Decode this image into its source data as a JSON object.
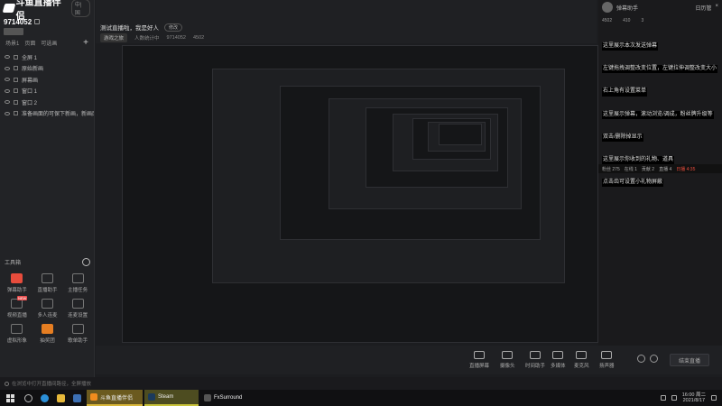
{
  "app": {
    "name": "斗鱼直播伴侣",
    "version_badge": "中|国"
  },
  "room": {
    "id": "9714052"
  },
  "scenes": {
    "tabs": [
      "场景1",
      "页面",
      "可选画"
    ],
    "add": "+"
  },
  "sources": [
    {
      "label": "全屏 1"
    },
    {
      "label": "原始新画"
    },
    {
      "label": "屏幕画"
    },
    {
      "label": "窗口 1"
    },
    {
      "label": "窗口 2"
    },
    {
      "label": "准备画面的可保下新画，新画面"
    }
  ],
  "toolbox": {
    "title": "工具箱",
    "tools": [
      {
        "label": "弹幕助手",
        "color": "red",
        "tag": ""
      },
      {
        "label": "直播助手",
        "color": "",
        "tag": ""
      },
      {
        "label": "主播任务",
        "color": "",
        "tag": ""
      },
      {
        "label": "视频直播",
        "color": "",
        "tag": "NEW"
      },
      {
        "label": "多人连麦",
        "color": "",
        "tag": ""
      },
      {
        "label": "连麦设置",
        "color": "",
        "tag": ""
      },
      {
        "label": "虚拟形象",
        "color": "",
        "tag": ""
      },
      {
        "label": "抽奖团",
        "color": "orange",
        "tag": ""
      },
      {
        "label": "歌单助手",
        "color": "",
        "tag": ""
      }
    ]
  },
  "broadcast": {
    "title": "测试直播啦，我是好人",
    "edit_label": "修改",
    "category": "游戏之旅",
    "meta": [
      "人数统计中",
      "9714052",
      "4502"
    ]
  },
  "right_panel": {
    "header_name": "弹幕助手",
    "links": [
      "日历管",
      "×"
    ],
    "stats": [
      "4502",
      "410",
      "3"
    ],
    "chat": [
      "这里展示本次发送弹幕",
      "左键拖拽调整改变位置，左键拉伸调整改变大小",
      "右上角有设置菜单",
      "这里展示弹幕，滚动浏览/调成，粉丝牌升级等",
      "双击/删除掉显示",
      "这里展示你收到的礼物、道具",
      "点击齿可设置小礼物屏蔽"
    ],
    "bottom": [
      "粉丝 275",
      "在线 1",
      "贡献 2",
      "直播 4"
    ],
    "live_text": "日播 4:35"
  },
  "controls": {
    "buttons": [
      "直播屏幕",
      "摄像头",
      "时间助手",
      "多媒体",
      "麦克风",
      "扬声器"
    ],
    "start_label": "结束直播"
  },
  "status_bar": {
    "text": "在浏览中打开直播间路径，全屏播放"
  },
  "taskbar": {
    "tasks": [
      "斗鱼直播伴侣",
      "Steam",
      "FxSurround"
    ],
    "time": "16:00 周二",
    "date": "2021/8/17"
  }
}
